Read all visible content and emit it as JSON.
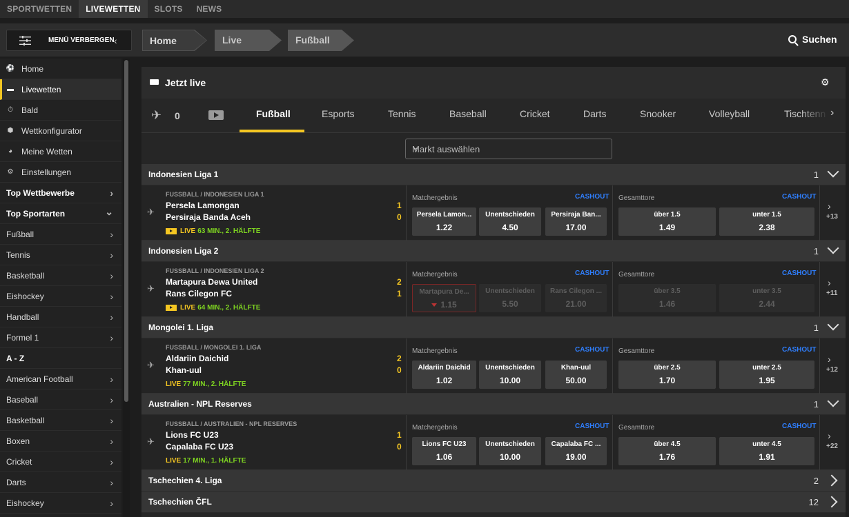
{
  "topnav": [
    "SPORTWETTEN",
    "LIVEWETTEN",
    "SLOTS",
    "NEWS"
  ],
  "menu_button": "MENÜ VERBERGEN",
  "breadcrumbs": [
    "Home",
    "Live",
    "Fußball"
  ],
  "search_label": "Suchen",
  "sidebar": [
    {
      "label": "Home",
      "icon": "soccer-ball-icon"
    },
    {
      "label": "Livewetten",
      "icon": "tv-icon",
      "active": true
    },
    {
      "label": "Bald",
      "icon": "stopwatch-icon"
    },
    {
      "label": "Wettkonfigurator",
      "icon": "configurator-icon"
    },
    {
      "label": "Meine Wetten",
      "icon": "pie-icon"
    },
    {
      "label": "Einstellungen",
      "icon": "gear-icon"
    },
    {
      "label": "Top Wettbewerbe",
      "bold": true,
      "arrow": "right"
    },
    {
      "label": "Top Sportarten",
      "bold": true,
      "arrow": "down"
    },
    {
      "label": "Fußball",
      "arrow": "right"
    },
    {
      "label": "Tennis",
      "arrow": "right"
    },
    {
      "label": "Basketball",
      "arrow": "right"
    },
    {
      "label": "Eishockey",
      "arrow": "right"
    },
    {
      "label": "Handball",
      "arrow": "right"
    },
    {
      "label": "Formel 1",
      "arrow": "right"
    },
    {
      "label": "A - Z",
      "bold": true
    },
    {
      "label": "American Football",
      "arrow": "right"
    },
    {
      "label": "Baseball",
      "arrow": "right"
    },
    {
      "label": "Basketball",
      "arrow": "right"
    },
    {
      "label": "Boxen",
      "arrow": "right"
    },
    {
      "label": "Cricket",
      "arrow": "right"
    },
    {
      "label": "Darts",
      "arrow": "right"
    },
    {
      "label": "Eishockey",
      "arrow": "right"
    }
  ],
  "live_header": "Jetzt live",
  "favorites_count": "0",
  "sport_tabs": [
    "Fußball",
    "Esports",
    "Tennis",
    "Baseball",
    "Cricket",
    "Darts",
    "Snooker",
    "Volleyball",
    "Tischtennis"
  ],
  "market_select_placeholder": "Markt auswählen",
  "labels": {
    "match_result": "Matchergebnis",
    "total_goals": "Gesamttore",
    "cashout": "CASHOUT",
    "live": "LIVE"
  },
  "leagues": [
    {
      "name": "Indonesien Liga 1",
      "count": "1",
      "expanded": true,
      "event": {
        "competition": "FUSSBALL / INDONESIEN LIGA 1",
        "team1": "Persela Lamongan",
        "team2": "Persiraja Banda Aceh",
        "score1": "1",
        "score2": "0",
        "status": "63 MIN., 2. HÄLFTE",
        "has_video": true,
        "odds_result": [
          {
            "name": "Persela Lamon...",
            "value": "1.22"
          },
          {
            "name": "Unentschieden",
            "value": "4.50"
          },
          {
            "name": "Persiraja Ban...",
            "value": "17.00"
          }
        ],
        "odds_goals": [
          {
            "name": "über 1.5",
            "value": "1.49"
          },
          {
            "name": "unter 1.5",
            "value": "2.38"
          }
        ],
        "more": "+13",
        "suspended": false
      }
    },
    {
      "name": "Indonesien Liga 2",
      "count": "1",
      "expanded": true,
      "event": {
        "competition": "FUSSBALL / INDONESIEN LIGA 2",
        "team1": "Martapura Dewa United",
        "team2": "Rans Cilegon FC",
        "score1": "2",
        "score2": "1",
        "status": "64 MIN., 2. HÄLFTE",
        "has_video": true,
        "odds_result": [
          {
            "name": "Martapura De...",
            "value": "1.15"
          },
          {
            "name": "Unentschieden",
            "value": "5.50"
          },
          {
            "name": "Rans Cilegon ...",
            "value": "21.00"
          }
        ],
        "odds_goals": [
          {
            "name": "über 3.5",
            "value": "1.46"
          },
          {
            "name": "unter 3.5",
            "value": "2.44"
          }
        ],
        "more": "+11",
        "suspended": true
      }
    },
    {
      "name": "Mongolei 1. Liga",
      "count": "1",
      "expanded": true,
      "event": {
        "competition": "FUSSBALL / MONGOLEI 1. LIGA",
        "team1": "Aldariin Daichid",
        "team2": "Khan-uul",
        "score1": "2",
        "score2": "0",
        "status": "77 MIN., 2. HÄLFTE",
        "has_video": false,
        "odds_result": [
          {
            "name": "Aldariin Daichid",
            "value": "1.02"
          },
          {
            "name": "Unentschieden",
            "value": "10.00"
          },
          {
            "name": "Khan-uul",
            "value": "50.00"
          }
        ],
        "odds_goals": [
          {
            "name": "über 2.5",
            "value": "1.70"
          },
          {
            "name": "unter 2.5",
            "value": "1.95"
          }
        ],
        "more": "+12",
        "suspended": false
      }
    },
    {
      "name": "Australien - NPL Reserves",
      "count": "1",
      "expanded": true,
      "event": {
        "competition": "FUSSBALL / AUSTRALIEN - NPL RESERVES",
        "team1": "Lions FC U23",
        "team2": "Capalaba FC U23",
        "score1": "1",
        "score2": "0",
        "status": "17 MIN., 1. HÄLFTE",
        "has_video": false,
        "odds_result": [
          {
            "name": "Lions FC U23",
            "value": "1.06"
          },
          {
            "name": "Unentschieden",
            "value": "10.00"
          },
          {
            "name": "Capalaba FC ...",
            "value": "19.00"
          }
        ],
        "odds_goals": [
          {
            "name": "über 4.5",
            "value": "1.76"
          },
          {
            "name": "unter 4.5",
            "value": "1.91"
          }
        ],
        "more": "+22",
        "suspended": false
      }
    },
    {
      "name": "Tschechien 4. Liga",
      "count": "2",
      "expanded": false
    },
    {
      "name": "Tschechien ČFL",
      "count": "12",
      "expanded": false
    }
  ],
  "colors": {
    "accent": "#f4c622",
    "cashout": "#2f7fff",
    "live_green": "#7ed321",
    "background": "#1d1d1d"
  }
}
